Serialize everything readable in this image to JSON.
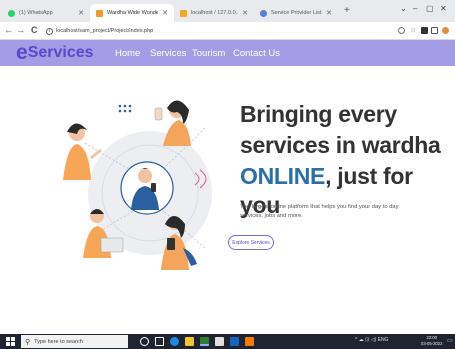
{
  "browser": {
    "tabs": [
      {
        "title": "(1) WhatsApp",
        "color": "#25d366"
      },
      {
        "title": "Wardha Wide Wonder",
        "color": "#f29a2e"
      },
      {
        "title": "localhost / 127.0.0.1 / wardha_w",
        "color": "#f5a623"
      },
      {
        "title": "Service Provider List",
        "color": "#5a7be0"
      }
    ],
    "new_tab": "+",
    "window_controls": [
      "⌄",
      "–",
      "▢",
      "✕"
    ],
    "address": "localhost/sam_project/Project/index.php",
    "nav": {
      "back": "←",
      "forward": "→",
      "reload": "C"
    }
  },
  "site": {
    "logo_letter": "e",
    "logo_text": "Services",
    "brand_color": "#5a49c9",
    "nav_color": "#a59ce6",
    "nav_links": [
      "Home",
      "Services",
      "Tourism",
      "Contact Us"
    ]
  },
  "hero": {
    "line1": "Bringing every",
    "line2": "services in wardha",
    "line3_accent": "ONLINE",
    "line3_rest": ", just for you",
    "tagline": "The largest online platform that helps you find your day to day services, jobs and more.",
    "cta": "Explore Services",
    "illustration": "people-network-illustration"
  },
  "taskbar": {
    "search_placeholder": "Type here to search",
    "tray": "^  ☁  ⊡  ◁)  ENG",
    "time": "23:00",
    "date": "03-05-2022"
  }
}
